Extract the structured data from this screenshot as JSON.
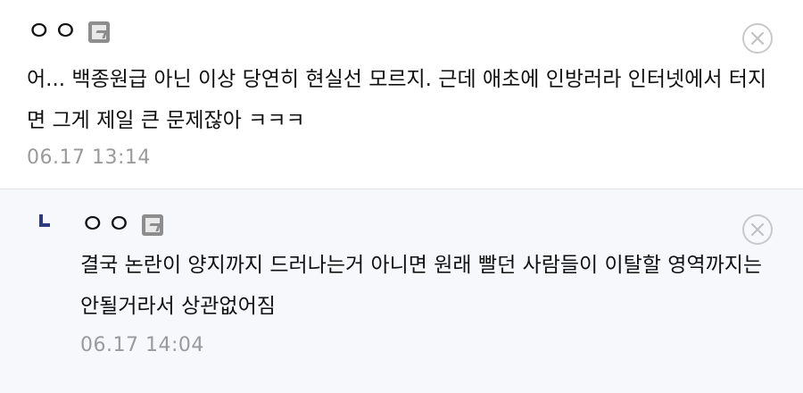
{
  "comments": [
    {
      "author": "ㅇㅇ",
      "text": "어... 백종원급 아닌 이상 당연히 현실선 모르지. 근데 애초에 인방러라 인터넷에서 터지면 그게 제일 큰 문제잖아 ㅋㅋㅋ",
      "time": "06.17 13:14"
    },
    {
      "author": "ㅇㅇ",
      "text": "결국 논란이 양지까지 드러나는거 아니면 원래 빨던 사람들이 이탈할 영역까지는 안될거라서 상관없어짐",
      "time": "06.17 14:04"
    }
  ],
  "icons": {
    "badge": "fixed-nick-badge-icon",
    "close": "close-circle-icon",
    "reply": "reply-arrow-icon"
  },
  "colors": {
    "reply_background": "#f7f8fc",
    "timestamp": "#9a9a9a",
    "reply_arrow": "#2f3a7a"
  }
}
